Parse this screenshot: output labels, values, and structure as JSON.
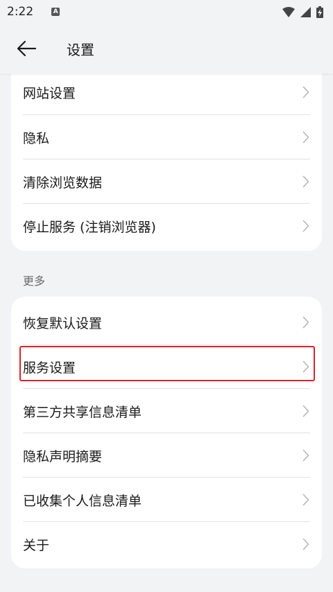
{
  "status_bar": {
    "time": "2:22",
    "notification_glyph": "A",
    "icons": [
      "wifi-icon",
      "signal-icon",
      "battery-charging-icon"
    ]
  },
  "header": {
    "back_icon": "arrow-left-icon",
    "title": "设置"
  },
  "group1": {
    "items": [
      {
        "label": "网站设置",
        "icon": "chevron-right-icon"
      },
      {
        "label": "隐私",
        "icon": "chevron-right-icon"
      },
      {
        "label": "清除浏览数据",
        "icon": "chevron-right-icon"
      },
      {
        "label": "停止服务 (注销浏览器)",
        "icon": "chevron-right-icon"
      }
    ]
  },
  "group2": {
    "section_title": "更多",
    "items": [
      {
        "label": "恢复默认设置",
        "icon": "chevron-right-icon"
      },
      {
        "label": "服务设置",
        "icon": "chevron-right-icon"
      },
      {
        "label": "第三方共享信息清单",
        "icon": "chevron-right-icon"
      },
      {
        "label": "隐私声明摘要",
        "icon": "chevron-right-icon"
      },
      {
        "label": "已收集个人信息清单",
        "icon": "chevron-right-icon"
      },
      {
        "label": "关于",
        "icon": "chevron-right-icon"
      }
    ]
  },
  "colors": {
    "background": "#f1f3f5",
    "card": "#ffffff",
    "highlight_border": "#e0202a",
    "chevron": "#b5b5b5"
  }
}
